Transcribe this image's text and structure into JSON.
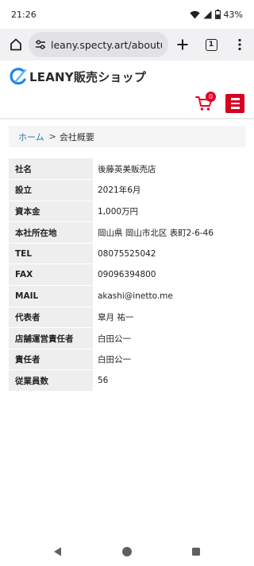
{
  "status_bar": {
    "time": "21:26",
    "battery": "43%",
    "icons": [
      "wifi-icon",
      "signal-icon",
      "battery-icon"
    ]
  },
  "browser": {
    "url": "leany.specty.art/aboutus.ht",
    "tab_count": "1",
    "icons": [
      "home-icon",
      "site-settings-icon",
      "new-tab-icon",
      "tab-switcher-icon",
      "overflow-menu-icon"
    ]
  },
  "header": {
    "logo_text": "LEANY販売ショップ",
    "cart_count": "0",
    "brand_color": "#d7001f",
    "logo_color": "#1e88e5"
  },
  "breadcrumb": {
    "home": "ホーム",
    "separator": ">",
    "current": "会社概要"
  },
  "company_table": {
    "rows": [
      {
        "label": "社名",
        "value": "後藤英美販売店"
      },
      {
        "label": "設立",
        "value": " 2021年6月"
      },
      {
        "label": "資本金",
        "value": " 1,000万円"
      },
      {
        "label": "本社所在地",
        "value": " 岡山県 岡山市北区 表町2-6-46"
      },
      {
        "label": "TEL",
        "value": "08075525042"
      },
      {
        "label": "FAX",
        "value": "09096394800"
      },
      {
        "label": "MAIL",
        "value": "akashi@inetto.me"
      },
      {
        "label": "代表者",
        "value": "皐月 祐一"
      },
      {
        "label": "店舗運営責任者",
        "value": "白田公一"
      },
      {
        "label": "責任者",
        "value": "白田公一"
      },
      {
        "label": "従業員数",
        "value": "56"
      }
    ]
  }
}
